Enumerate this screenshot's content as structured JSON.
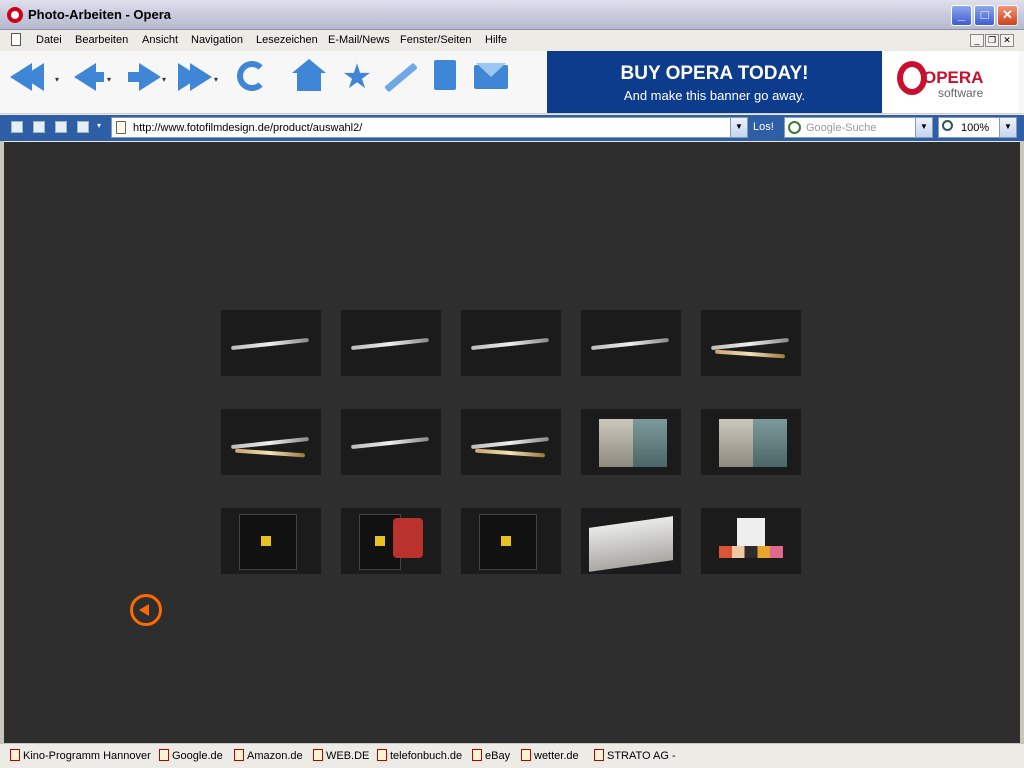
{
  "window": {
    "title": "Photo-Arbeiten - Opera",
    "min_label": "_",
    "max_label": "□",
    "close_label": "✕"
  },
  "menu": [
    "Datei",
    "Bearbeiten",
    "Ansicht",
    "Navigation",
    "Lesezeichen",
    "E-Mail/News",
    "Fenster/Seiten",
    "Hilfe"
  ],
  "toolbar": {
    "icons": [
      "rewind-icon",
      "back-icon",
      "forward-icon",
      "fast-forward-icon",
      "reload-icon",
      "home-icon",
      "bookmark-star-icon",
      "pen-icon",
      "page-icon",
      "mail-icon"
    ],
    "drop": "▾"
  },
  "banner": {
    "line1": "BUY OPERA TODAY!",
    "line2": "And make this banner go away."
  },
  "logo": {
    "line1": "OPERA",
    "line2": "software"
  },
  "address": {
    "url": "http://www.fotofilmdesign.de/product/auswahl2/",
    "go": "Los!",
    "search_placeholder": "Google-Suche",
    "zoom": "100%",
    "dropdown": "▼"
  },
  "gallery": {
    "rows": 3,
    "columns": 5,
    "thumbnails": [
      {
        "kind": "pen"
      },
      {
        "kind": "pen"
      },
      {
        "kind": "pen"
      },
      {
        "kind": "pen"
      },
      {
        "kind": "pens"
      },
      {
        "kind": "pens"
      },
      {
        "kind": "pen"
      },
      {
        "kind": "pens"
      },
      {
        "kind": "book"
      },
      {
        "kind": "book"
      },
      {
        "kind": "box"
      },
      {
        "kind": "box-red"
      },
      {
        "kind": "box"
      },
      {
        "kind": "paper"
      },
      {
        "kind": "card"
      }
    ]
  },
  "bookmarks": [
    "Kino-Programm  Hannover",
    "Google.de",
    "Amazon.de",
    "WEB.DE",
    "telefonbuch.de",
    "eBay",
    "wetter.de",
    "STRATO AG -"
  ],
  "colors": {
    "accent": "#ff6a00",
    "content_bg": "#2e2e2e",
    "banner_bg": "#0e3c8c",
    "address_bar": "#2d5ea6"
  }
}
